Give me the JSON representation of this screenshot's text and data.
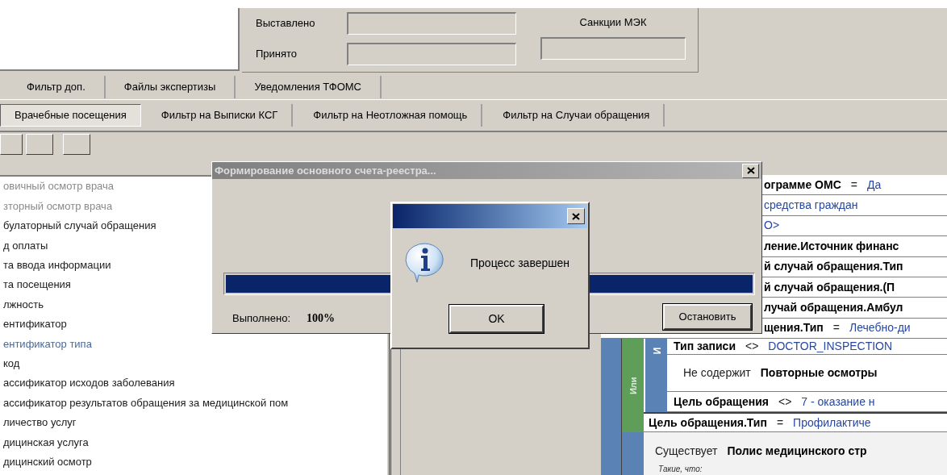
{
  "summary": {
    "fields": [
      {
        "label": "Выставлено"
      },
      {
        "label": "Принято"
      }
    ],
    "sanctions": {
      "label": "Санкции МЭК"
    }
  },
  "tabs_top": [
    {
      "label": "Фильтр доп.",
      "selected": false
    },
    {
      "label": "Файлы экспертизы",
      "selected": false
    },
    {
      "label": "Уведомления ТФОМС",
      "selected": false
    }
  ],
  "tabs_filters": [
    {
      "label": "Врачебные посещения",
      "selected": true
    },
    {
      "label": "Фильтр на Выписки КСГ",
      "selected": false
    },
    {
      "label": "Фильтр на Неотложная помощь",
      "selected": false
    },
    {
      "label": "Фильтр на Случаи обращения",
      "selected": false
    }
  ],
  "fields": [
    {
      "label": "овичный осмотр врача",
      "kind": "muted"
    },
    {
      "label": "зторный осмотр врача",
      "kind": "muted"
    },
    {
      "label": "булаторный случай обращения",
      "kind": "normal"
    },
    {
      "label": "д оплаты",
      "kind": "normal"
    },
    {
      "label": "та ввода информации",
      "kind": "normal"
    },
    {
      "label": "та посещения",
      "kind": "normal"
    },
    {
      "label": "лжность",
      "kind": "normal"
    },
    {
      "label": "ентификатор",
      "kind": "normal"
    },
    {
      "label": "ентификатор типа",
      "kind": "link"
    },
    {
      "label": "код",
      "kind": "normal"
    },
    {
      "label": "ассификатор исходов заболевания",
      "kind": "normal"
    },
    {
      "label": "ассификатор результатов обращения за медицинской пом",
      "kind": "normal"
    },
    {
      "label": "личество услуг",
      "kind": "normal"
    },
    {
      "label": "дицинская услуга",
      "kind": "normal"
    },
    {
      "label": "дицинский осмотр",
      "kind": "normal"
    }
  ],
  "conditions": {
    "rows": [
      {
        "field": "ограмме ОМС",
        "operator": "=",
        "value": "Да"
      },
      {
        "value": "средства граждан"
      },
      {
        "value": "O>"
      },
      {
        "field": "ление.Источник финанс"
      },
      {
        "field": "й случай обращения.Тип"
      },
      {
        "field": "й случай обращения.(П"
      },
      {
        "field": "лучай обращения.Амбул"
      },
      {
        "field": "щения.Тип",
        "operator": "=",
        "value": "Лечебно-ди"
      }
    ],
    "or_group": {
      "label": "Или",
      "and_group": {
        "label": "И",
        "rows": [
          {
            "field": "Тип записи",
            "operator": "<>",
            "value": "DOCTOR_INSPECTION"
          },
          {
            "prefix": "Не содержит",
            "field": "Повторные осмотры"
          },
          {
            "field": "Цель обращения",
            "operator": "<>",
            "value": "7 - оказание н"
          }
        ]
      },
      "rows": [
        {
          "field": "Цель обращения.Тип",
          "operator": "=",
          "value": "Профилактиче"
        }
      ]
    },
    "exists_group": {
      "rows": [
        {
          "prefix": "Существует",
          "field": "Полис медицинского стр"
        },
        {
          "note": "Такие, что:"
        }
      ]
    }
  },
  "progress_dialog": {
    "title": "Формирование основного счета-реестра...",
    "level": 1,
    "done_label": "Выполнено:",
    "percent": "100%",
    "button": "Остановить"
  },
  "message_box": {
    "message": "Процесс завершен",
    "button": "OK"
  }
}
